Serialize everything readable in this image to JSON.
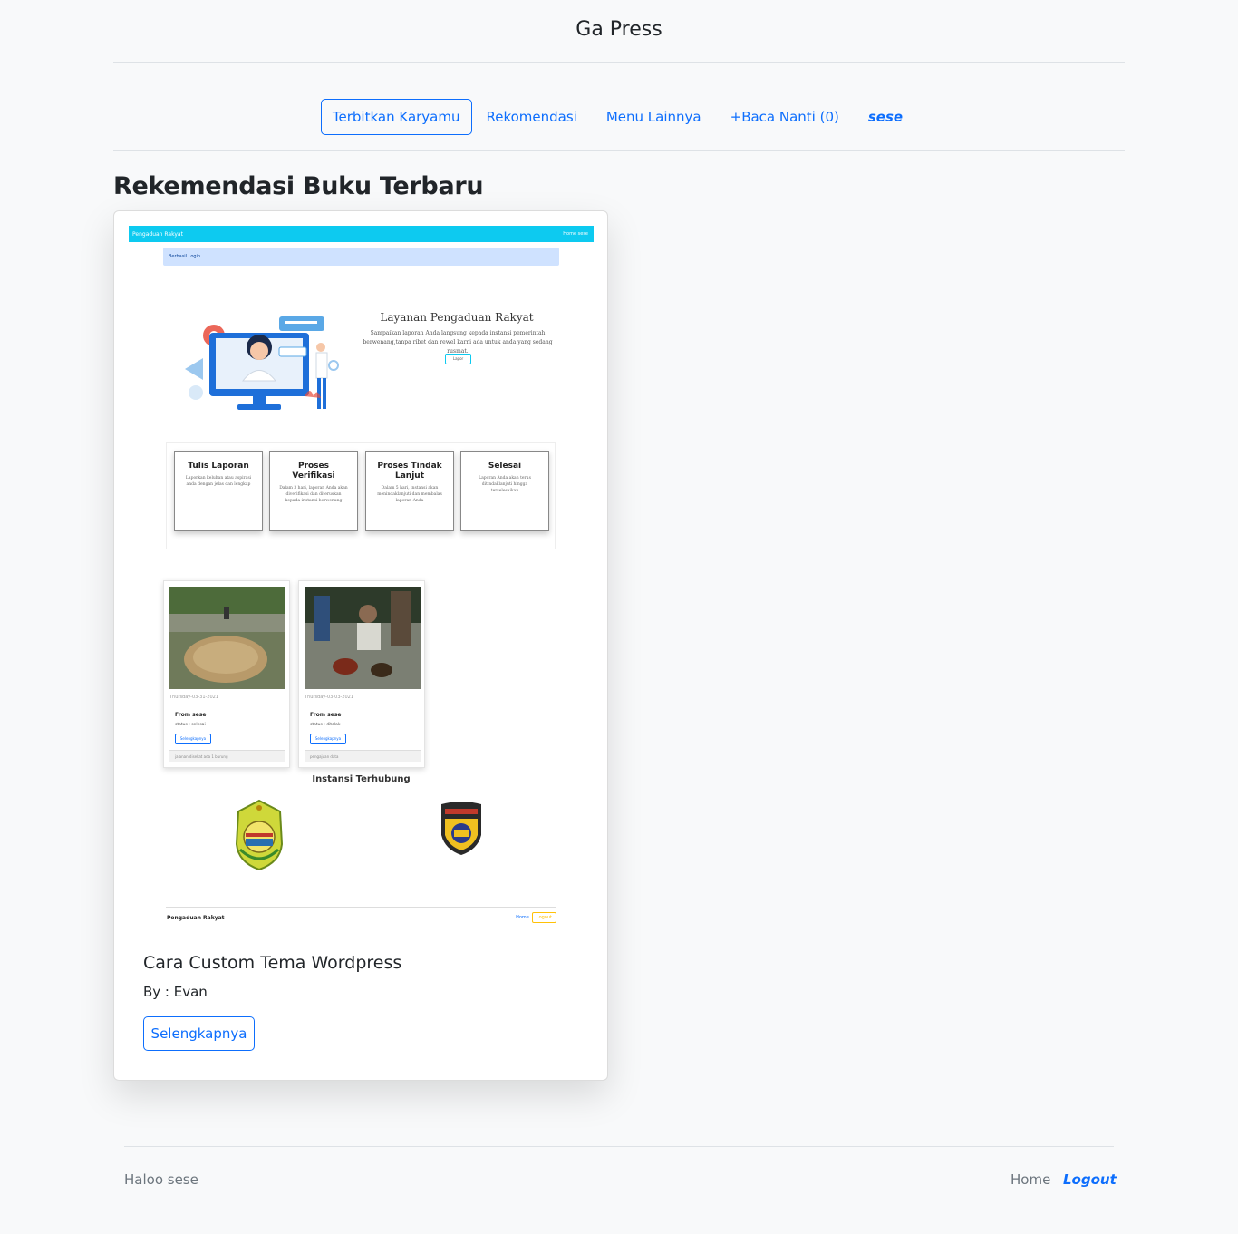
{
  "site": {
    "title": "Ga Press"
  },
  "nav": {
    "items": [
      {
        "label": "Terbitkan Karyamu"
      },
      {
        "label": "Rekomendasi"
      },
      {
        "label": "Menu Lainnya"
      },
      {
        "label": "+Baca Nanti (0)"
      },
      {
        "label": "sese"
      }
    ]
  },
  "section": {
    "heading": "Rekemendasi Buku Terbaru"
  },
  "book": {
    "title": "Cara Custom Tema Wordpress",
    "author": "By : Evan",
    "button_label": "Selengkapnya"
  },
  "thumbnail": {
    "nav_brand": "Pengaduan Rakyat",
    "nav_links": "Home   sese",
    "alert": "Berhasil Login",
    "hero_title": "Layanan Pengaduan Rakyat",
    "hero_text": "Sampaikan laporan Anda langsung kepada instansi pemerintah berwenang,tanpa ribet dan rewel karni ada untuk anda yang sedang rusmat.",
    "hero_button": "Lapor",
    "steps": [
      {
        "title": "Tulis Laporan",
        "desc": "Laporkan keluhan atau aspirasi anda dengan jelas dan lengkap"
      },
      {
        "title": "Proses Verifikasi",
        "desc": "Dalam 3 hari, laporan Anda akan diverifikasi dan diteruskan kepada instansi berwenang"
      },
      {
        "title": "Proses Tindak Lanjut",
        "desc": "Dalam 5 hari, instansi akan menindaklanjuti dan membalas laporan Anda"
      },
      {
        "title": "Selesai",
        "desc": "Laporan Anda akan terus ditindaklanjuti hingga terselesaikan"
      }
    ],
    "reports": [
      {
        "date": "Thursday-03-31-2021",
        "from": "From sese",
        "status": "status : selesai",
        "button": "Selengkapnya",
        "footer": "jalanan disekat ada 1 burung"
      },
      {
        "date": "Thursday-03-03-2021",
        "from": "From sese",
        "status": "status : ditolak",
        "button": "Selengkapnya",
        "footer": "pengajuan data"
      }
    ],
    "instansi_title": "Instansi Terhubung",
    "footer_brand": "Pengaduan Rakyat",
    "footer_home": "Home",
    "footer_logout": "Logout"
  },
  "footer": {
    "greeting": "Haloo sese",
    "home_label": "Home",
    "logout_label": "Logout"
  }
}
